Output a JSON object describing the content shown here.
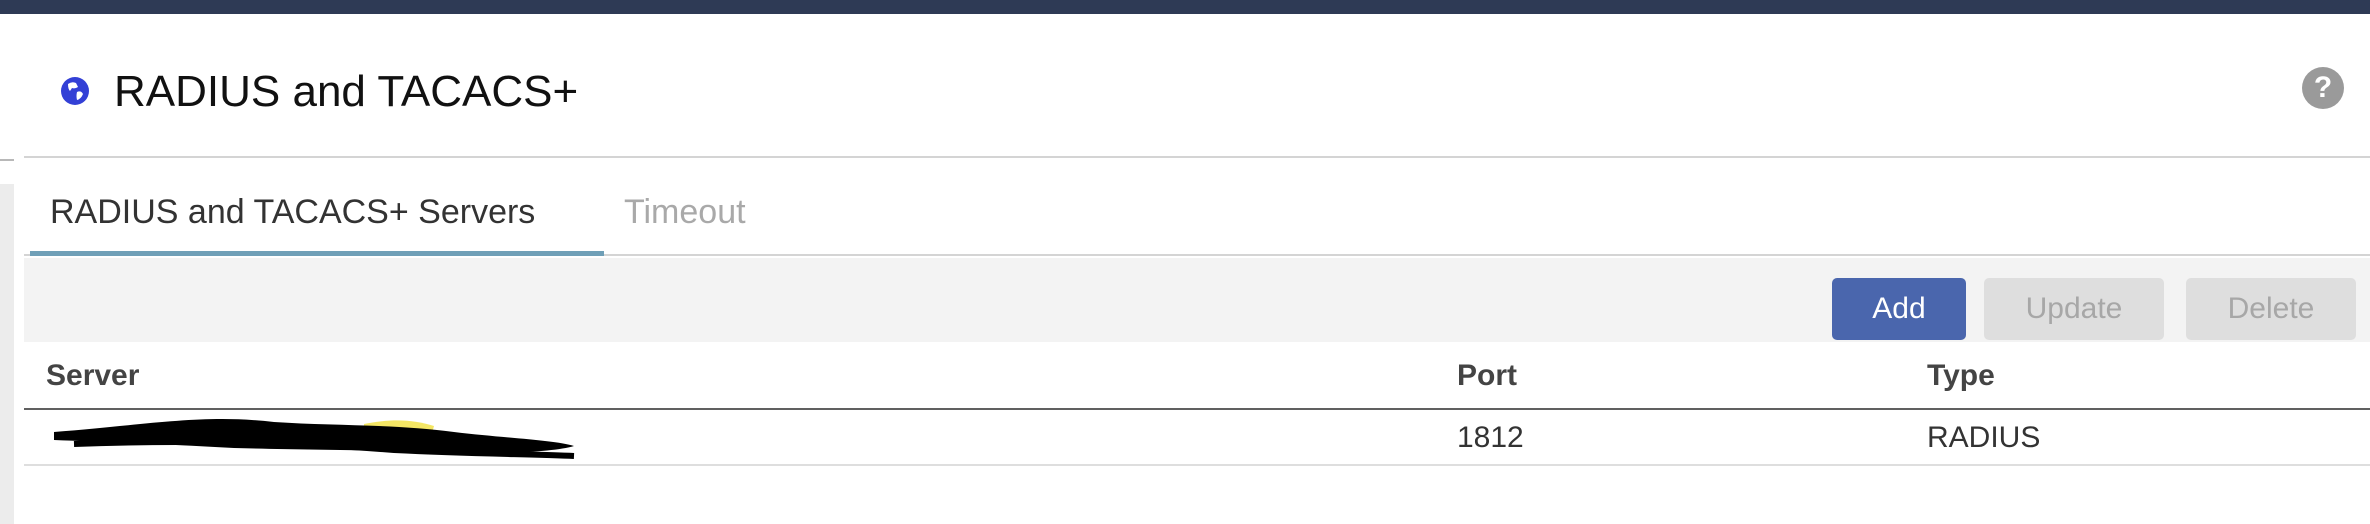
{
  "header": {
    "title": "RADIUS and TACACS+"
  },
  "tabs": [
    {
      "label": "RADIUS and TACACS+ Servers",
      "active": true
    },
    {
      "label": "Timeout",
      "active": false
    }
  ],
  "toolbar": {
    "add_label": "Add",
    "update_label": "Update",
    "delete_label": "Delete"
  },
  "table": {
    "columns": [
      "Server",
      "Port",
      "Type"
    ],
    "rows": [
      {
        "server": "",
        "port": "1812",
        "type": "RADIUS"
      }
    ]
  },
  "colors": {
    "topbar": "#2e3a55",
    "accent_tab": "#6f9fb7",
    "primary_button": "#4a66ad",
    "disabled_button": "#dedede"
  },
  "icons": {
    "header": "globe-icon",
    "help": "help-icon"
  }
}
